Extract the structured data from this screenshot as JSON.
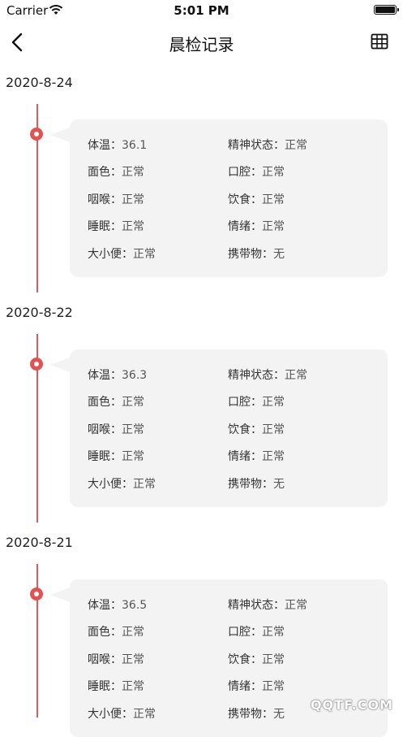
{
  "status_bar": {
    "carrier": "Carrier",
    "time": "5:01 PM"
  },
  "nav": {
    "title": "晨检记录"
  },
  "field_labels": {
    "temperature": "体温",
    "mental_state": "精神状态",
    "complexion": "面色",
    "oral_cavity": "口腔",
    "throat": "咽喉",
    "diet": "饮食",
    "sleep": "睡眠",
    "mood": "情绪",
    "stool": "大小便",
    "carried_items": "携带物"
  },
  "records": [
    {
      "date": "2020-8-24",
      "temperature": "36.1",
      "mental_state": "正常",
      "complexion": "正常",
      "oral_cavity": "正常",
      "throat": "正常",
      "diet": "正常",
      "sleep": "正常",
      "mood": "正常",
      "stool": "正常",
      "carried_items": "无"
    },
    {
      "date": "2020-8-22",
      "temperature": "36.3",
      "mental_state": "正常",
      "complexion": "正常",
      "oral_cavity": "正常",
      "throat": "正常",
      "diet": "正常",
      "sleep": "正常",
      "mood": "正常",
      "stool": "正常",
      "carried_items": "无"
    },
    {
      "date": "2020-8-21",
      "temperature": "36.5",
      "mental_state": "正常",
      "complexion": "正常",
      "oral_cavity": "正常",
      "throat": "正常",
      "diet": "正常",
      "sleep": "正常",
      "mood": "正常",
      "stool": "正常",
      "carried_items": "无"
    }
  ],
  "watermark": "QQTF.COM",
  "colors": {
    "accent": "#e35252",
    "card_bg": "#f3f3f3"
  }
}
